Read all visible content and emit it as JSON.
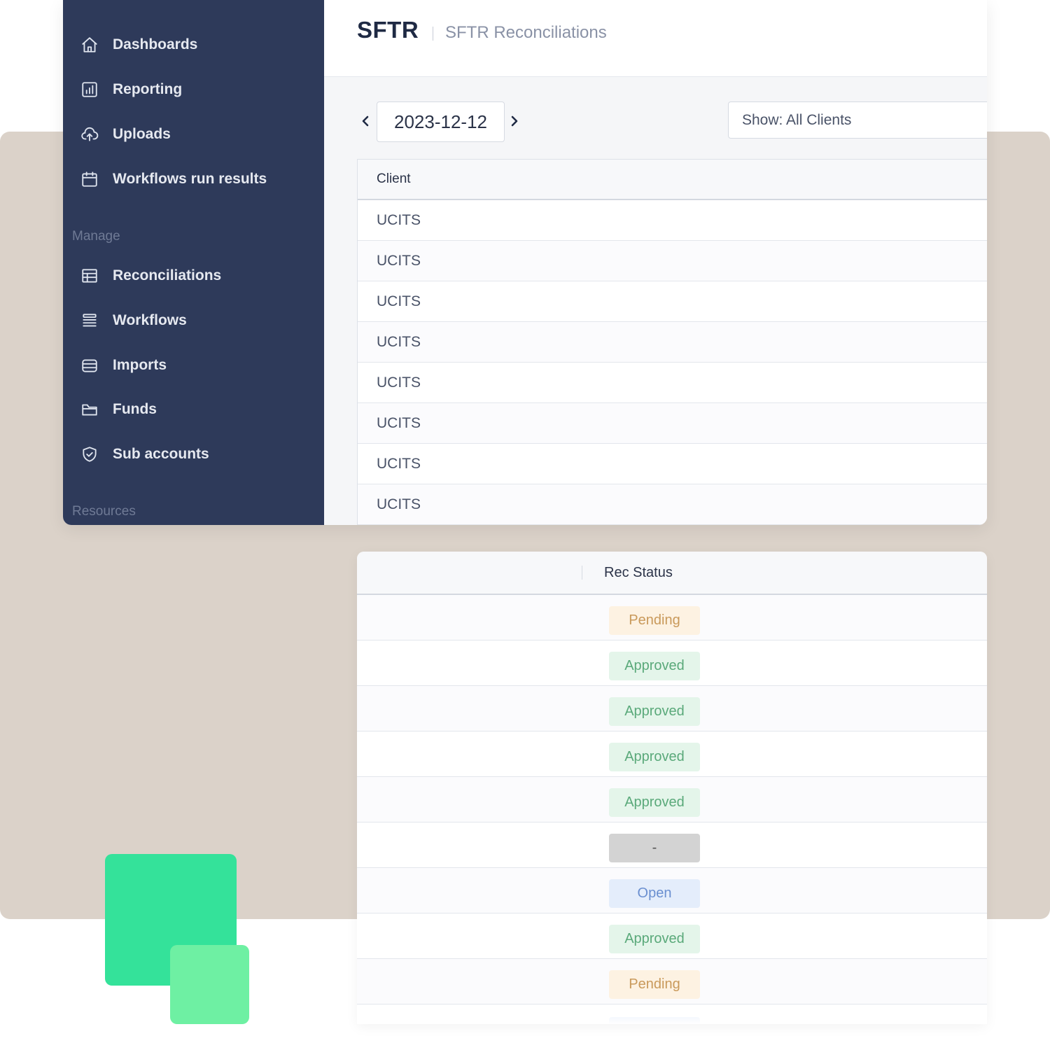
{
  "sidebar": {
    "items": [
      {
        "label": "Dashboards",
        "icon": "home-icon"
      },
      {
        "label": "Reporting",
        "icon": "chart-icon"
      },
      {
        "label": "Uploads",
        "icon": "cloud-upload-icon"
      },
      {
        "label": "Workflows run results",
        "icon": "calendar-icon"
      }
    ],
    "manage_label": "Manage",
    "manage_items": [
      {
        "label": "Reconciliations",
        "icon": "table-icon"
      },
      {
        "label": "Workflows",
        "icon": "stack-icon"
      },
      {
        "label": "Imports",
        "icon": "database-icon"
      },
      {
        "label": "Funds",
        "icon": "folder-icon"
      },
      {
        "label": "Sub accounts",
        "icon": "shield-check-icon"
      }
    ],
    "resources_label": "Resources"
  },
  "header": {
    "title": "SFTR",
    "subtitle": "SFTR Reconciliations"
  },
  "filters": {
    "date": "2023-12-12",
    "client_filter": "Show: All Clients"
  },
  "client_table": {
    "header": "Client",
    "rows": [
      "UCITS",
      "UCITS",
      "UCITS",
      "UCITS",
      "UCITS",
      "UCITS",
      "UCITS",
      "UCITS"
    ]
  },
  "status_table": {
    "header": "Rec Status",
    "rows": [
      {
        "status": "Pending",
        "kind": "pending"
      },
      {
        "status": "Approved",
        "kind": "approved"
      },
      {
        "status": "Approved",
        "kind": "approved"
      },
      {
        "status": "Approved",
        "kind": "approved"
      },
      {
        "status": "Approved",
        "kind": "approved"
      },
      {
        "status": "-",
        "kind": "none"
      },
      {
        "status": "Open",
        "kind": "open"
      },
      {
        "status": "Approved",
        "kind": "approved"
      },
      {
        "status": "Pending",
        "kind": "pending"
      }
    ]
  },
  "colors": {
    "sidebar": "#2e3a5a",
    "background_panel": "#dbd2c9",
    "accent_green": "#34e29a",
    "accent_green_light": "#6ef0a3"
  }
}
